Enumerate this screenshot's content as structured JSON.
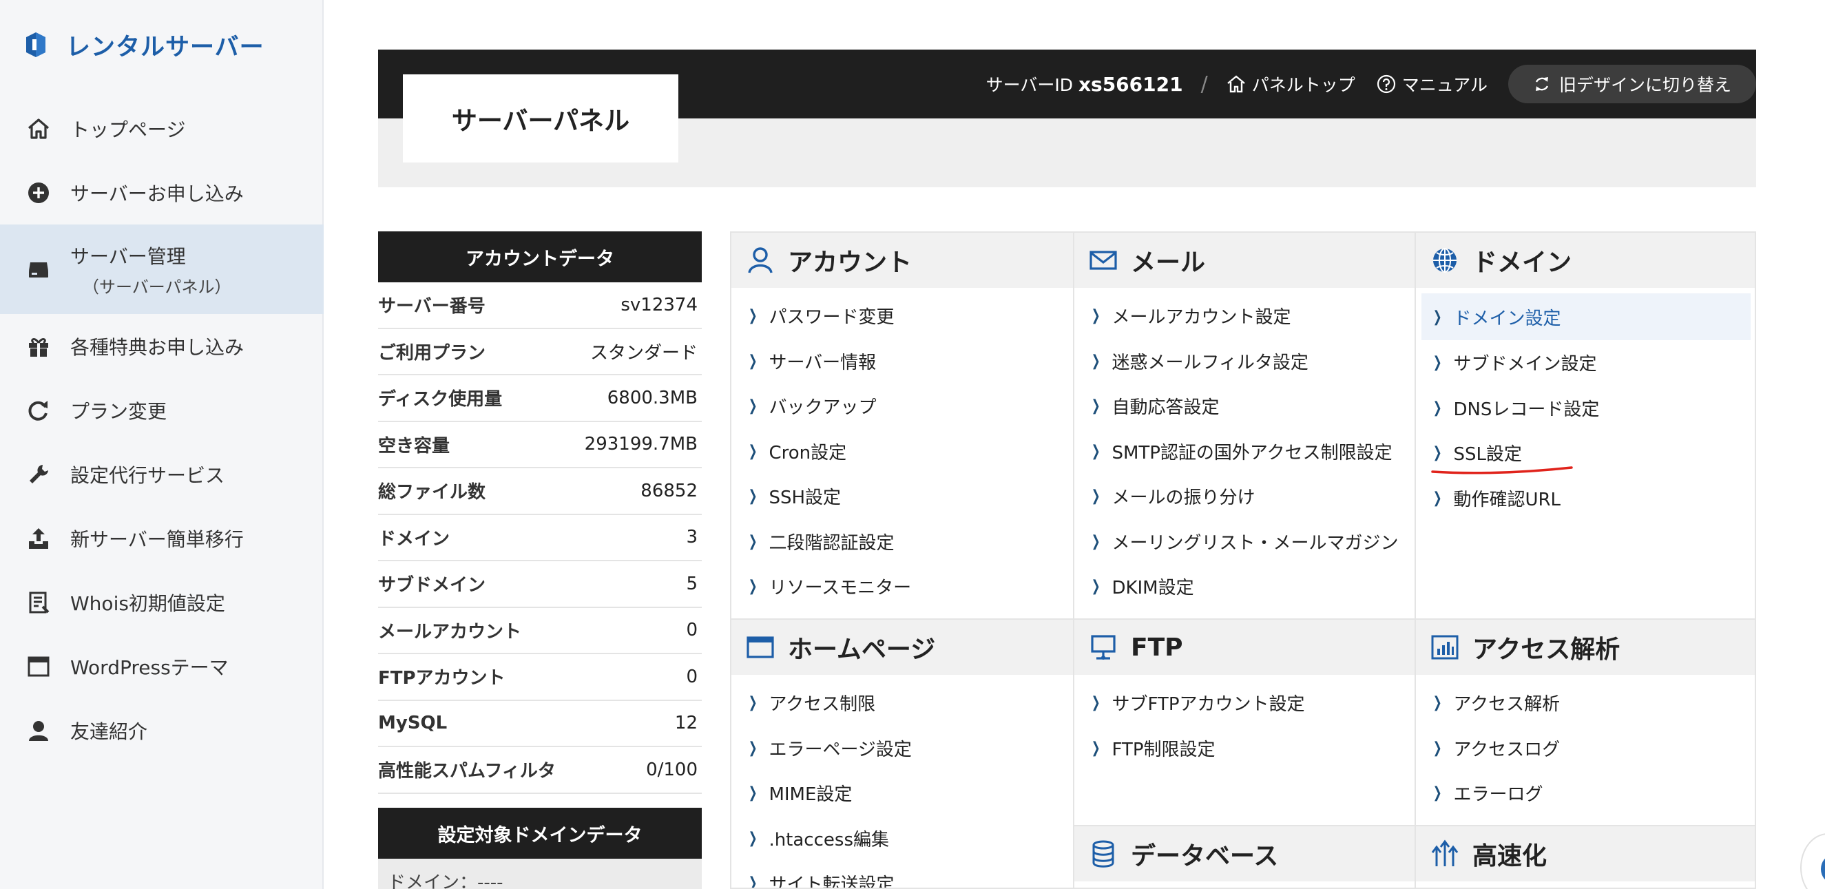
{
  "brand": {
    "logo_text": "レンタルサーバー",
    "color": "#1d5ea8"
  },
  "sidebar": {
    "items": [
      {
        "label": "トップページ",
        "icon": "home-icon"
      },
      {
        "label": "サーバーお申し込み",
        "icon": "plus-circle-icon"
      },
      {
        "label": "サーバー管理",
        "sub": "（サーバーパネル）",
        "icon": "server-icon",
        "active": true
      },
      {
        "label": "各種特典お申し込み",
        "icon": "gift-icon"
      },
      {
        "label": "プラン変更",
        "icon": "refresh-icon"
      },
      {
        "label": "設定代行サービス",
        "icon": "wrench-icon"
      },
      {
        "label": "新サーバー簡単移行",
        "icon": "upload-icon"
      },
      {
        "label": "Whois初期値設定",
        "icon": "document-icon"
      },
      {
        "label": "WordPressテーマ",
        "icon": "window-icon"
      },
      {
        "label": "友達紹介",
        "icon": "user-icon"
      }
    ]
  },
  "header": {
    "title": "サーバーパネル",
    "server_id_label": "サーバーID",
    "server_id_value": "xs566121",
    "separator": "/",
    "panel_top": "パネルトップ",
    "manual": "マニュアル",
    "switch_label": "旧デザインに切り替え"
  },
  "account": {
    "title": "アカウントデータ",
    "rows": [
      {
        "key": "サーバー番号",
        "value": "sv12374"
      },
      {
        "key": "ご利用プラン",
        "value": "スタンダード"
      },
      {
        "key": "ディスク使用量",
        "value": "6800.3MB"
      },
      {
        "key": "空き容量",
        "value": "293199.7MB"
      },
      {
        "key": "総ファイル数",
        "value": "86852"
      },
      {
        "key": "ドメイン",
        "value": "3"
      },
      {
        "key": "サブドメイン",
        "value": "5"
      },
      {
        "key": "メールアカウント",
        "value": "0"
      },
      {
        "key": "FTPアカウント",
        "value": "0"
      },
      {
        "key": "MySQL",
        "value": "12"
      },
      {
        "key": "高性能スパムフィルタ",
        "value": "0/100"
      }
    ],
    "domain_title": "設定対象ドメインデータ",
    "domain_row": "ドメイン：----"
  },
  "sections": {
    "account": {
      "title": "アカウント",
      "icon": "person-icon",
      "items": [
        "パスワード変更",
        "サーバー情報",
        "バックアップ",
        "Cron設定",
        "SSH設定",
        "二段階認証設定",
        "リソースモニター"
      ]
    },
    "mail": {
      "title": "メール",
      "icon": "mail-icon",
      "items": [
        "メールアカウント設定",
        "迷惑メールフィルタ設定",
        "自動応答設定",
        "SMTP認証の国外アクセス制限設定",
        "メールの振り分け",
        "メーリングリスト・メールマガジン",
        "DKIM設定"
      ]
    },
    "domain": {
      "title": "ドメイン",
      "icon": "globe-icon",
      "items": [
        "ドメイン設定",
        "サブドメイン設定",
        "DNSレコード設定",
        "SSL設定",
        "動作確認URL"
      ]
    },
    "homepage": {
      "title": "ホームページ",
      "icon": "browser-icon",
      "items": [
        "アクセス制限",
        "エラーページ設定",
        "MIME設定",
        ".htaccess編集",
        "サイト転送設定"
      ]
    },
    "ftp": {
      "title": "FTP",
      "icon": "monitor-icon",
      "items": [
        "サブFTPアカウント設定",
        "FTP制限設定"
      ]
    },
    "analytics": {
      "title": "アクセス解析",
      "icon": "bar-chart-icon",
      "items": [
        "アクセス解析",
        "アクセスログ",
        "エラーログ"
      ]
    },
    "database": {
      "title": "データベース",
      "icon": "database-icon"
    },
    "speed": {
      "title": "高速化",
      "icon": "speed-arrows-icon"
    }
  },
  "colors": {
    "accent": "#1d5ea8",
    "header_bg": "#1f1f1f",
    "selected_bg": "#eef3fa",
    "annotation": "#e0231b"
  }
}
